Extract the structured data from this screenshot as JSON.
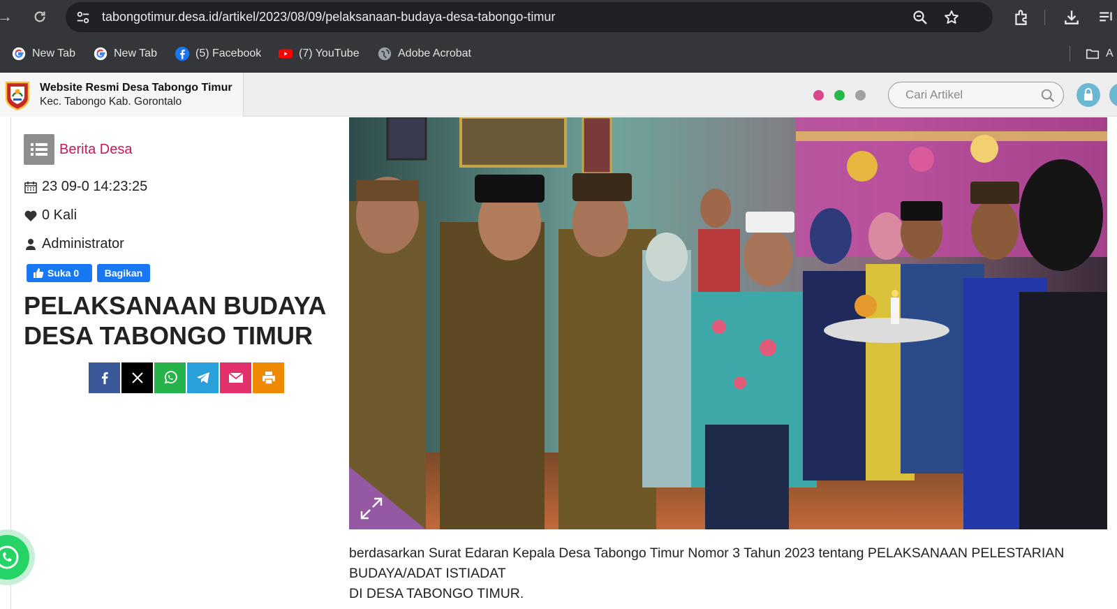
{
  "browser": {
    "url": "tabongotimur.desa.id/artikel/2023/08/09/pelaksanaan-budaya-desa-tabongo-timur",
    "bookmarks": [
      {
        "label": "New Tab",
        "icon": "google-icon"
      },
      {
        "label": "New Tab",
        "icon": "google-icon"
      },
      {
        "label": "(5) Facebook",
        "icon": "facebook-icon"
      },
      {
        "label": "(7) YouTube",
        "icon": "youtube-icon"
      },
      {
        "label": "Adobe Acrobat",
        "icon": "globe-icon"
      }
    ],
    "bookmark_folder": "A"
  },
  "site": {
    "title": "Website Resmi Desa Tabongo Timur",
    "subtitle": "Kec. Tabongo Kab. Gorontalo",
    "search_placeholder": "Cari Artikel",
    "dots": [
      "#d9468a",
      "#28b84a",
      "#a0a0a0"
    ]
  },
  "article": {
    "category": "Berita Desa",
    "date": "23 09-0 14:23:25",
    "likes": "0 Kali",
    "author": "Administrator",
    "fb_like_label": "Suka 0",
    "fb_share_label": "Bagikan",
    "title": "PELAKSANAAN BUDAYA DESA TABONGO TIMUR",
    "share_buttons": [
      {
        "name": "facebook",
        "color": "#3b5998"
      },
      {
        "name": "x",
        "color": "#000000"
      },
      {
        "name": "whatsapp",
        "color": "#25b34a"
      },
      {
        "name": "telegram",
        "color": "#2aa0da"
      },
      {
        "name": "email",
        "color": "#e1306c"
      },
      {
        "name": "print",
        "color": "#ef8a00"
      }
    ],
    "body_line1": "berdasarkan Surat Edaran Kepala Desa Tabongo Timur Nomor 3 Tahun 2023 tentang PELAKSANAAN PELESTARIAN BUDAYA/ADAT ISTIADAT",
    "body_line2": "DI DESA TABONGO TIMUR."
  }
}
